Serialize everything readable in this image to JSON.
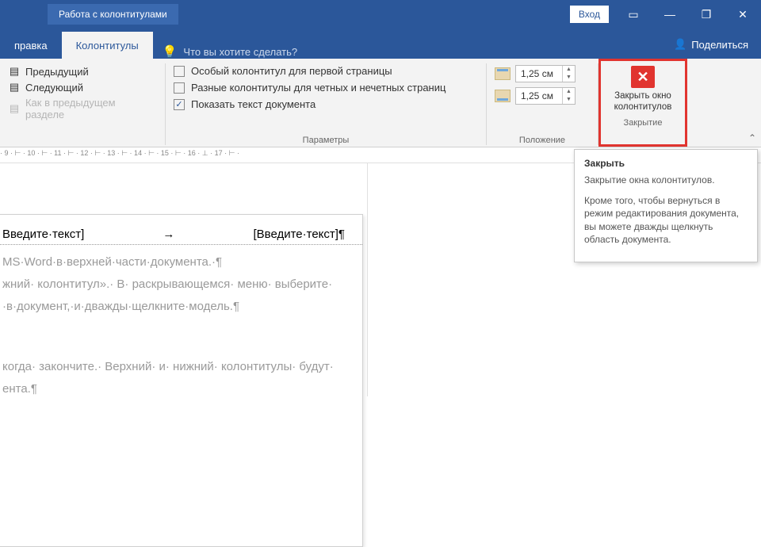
{
  "titlebar": {
    "context_label": "Работа с колонтитулами",
    "login": "Вход"
  },
  "tabs": {
    "edit": "правка",
    "header_footer": "Колонтитулы",
    "tellme": "Что вы хотите сделать?"
  },
  "share": "Поделиться",
  "ribbon": {
    "nav": {
      "prev": "Предыдущий",
      "next": "Следующий",
      "as_prev": "Как в предыдущем разделе"
    },
    "params": {
      "first_page": "Особый колонтитул для первой страницы",
      "odd_even": "Разные колонтитулы для четных и нечетных страниц",
      "show_text": "Показать текст документа",
      "label": "Параметры"
    },
    "position": {
      "top_val": "1,25 см",
      "bot_val": "1,25 см",
      "label": "Положение"
    },
    "close": {
      "line1": "Закрыть окно",
      "line2": "колонтитулов",
      "label": "Закрытие"
    }
  },
  "tooltip": {
    "title": "Закрыть",
    "p1": "Закрытие окна колонтитулов.",
    "p2": "Кроме того, чтобы вернуться в режим редактирования документа, вы можете дважды щелкнуть область документа."
  },
  "ruler_text": "· 9 · ⊢ · 10 · ⊢ · 11 · ⊢ · 12 · ⊢ · 13 · ⊢ · 14 · ⊢ · 15 · ⊢ · 16 · ⊥ · 17 · ⊢ ·",
  "doc": {
    "hdr_left": "Введите·текст]",
    "hdr_arrow": "→",
    "hdr_right": "[Введите·текст]¶",
    "body1": "MS·Word·в·верхней·части·документа.·¶",
    "body2": "жний· колонтитул».· В· раскрывающемся· меню· выбери­те·",
    "body3": "·в·документ,·и·дважды·щелкните·модель.¶",
    "body4": "когда· закончите.· Верхний· и· нижний· колонтитулы· будут·",
    "body5": "ента.¶"
  }
}
